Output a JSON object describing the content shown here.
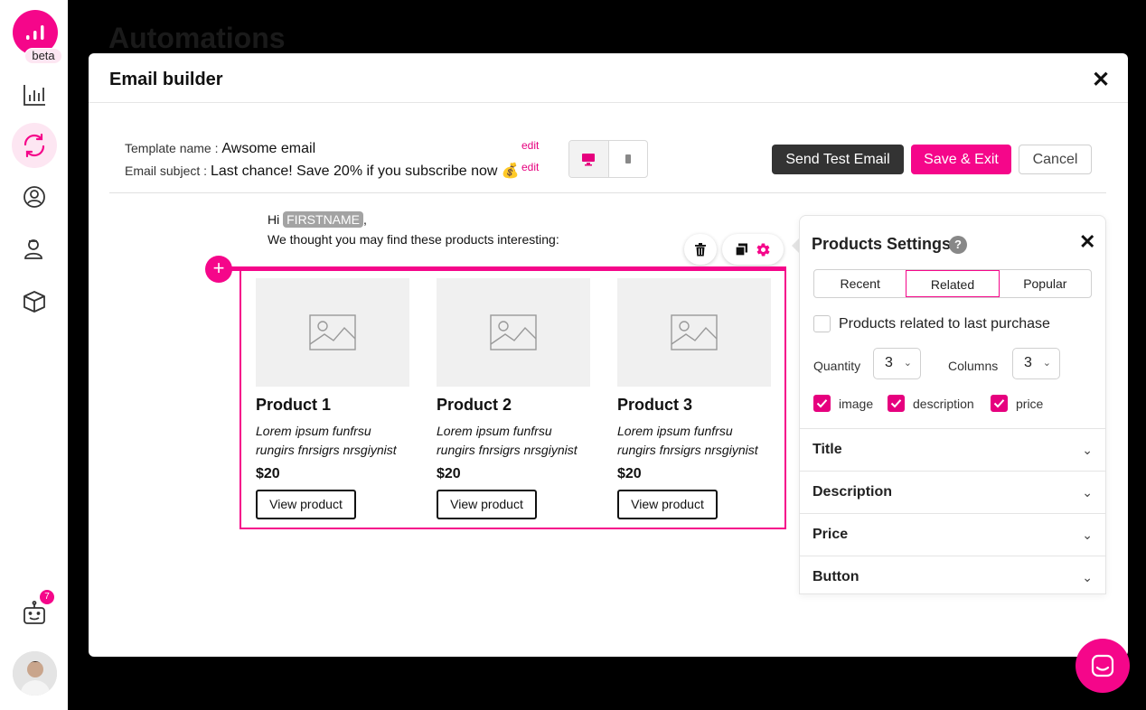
{
  "background": {
    "page_title": "Automations"
  },
  "sidebar": {
    "beta_label": "beta",
    "items": [
      {
        "icon": "analytics-icon"
      },
      {
        "icon": "automations-icon",
        "active": true
      },
      {
        "icon": "audience-icon"
      },
      {
        "icon": "contacts-icon"
      },
      {
        "icon": "products-icon"
      }
    ],
    "bot_badge_count": "7"
  },
  "modal": {
    "title": "Email builder",
    "close_glyph": "✕",
    "template_name_label": "Template name :",
    "template_name_value": "Awsome email",
    "email_subject_label": "Email subject :",
    "email_subject_value": "Last chance! Save 20% if you subscribe now 💰",
    "edit_label": "edit",
    "buttons": {
      "send_test": "Send Test Email",
      "save_exit": "Save & Exit",
      "cancel": "Cancel"
    }
  },
  "email": {
    "greeting_prefix": "Hi",
    "firstname_tag": "FIRSTNAME",
    "greeting_suffix": ",",
    "intro": "We thought you may find these products interesting:",
    "products": [
      {
        "title": "Product 1",
        "description": "Lorem ipsum funfrsu rungirs fnrsigrs nrsgiynist",
        "price": "$20",
        "button": "View product"
      },
      {
        "title": "Product 2",
        "description": "Lorem ipsum funfrsu rungirs fnrsigrs nrsgiynist",
        "price": "$20",
        "button": "View product"
      },
      {
        "title": "Product 3",
        "description": "Lorem ipsum funfrsu rungirs fnrsigrs nrsgiynist",
        "price": "$20",
        "button": "View product"
      }
    ]
  },
  "settings": {
    "title": "Products Settings",
    "help_glyph": "?",
    "close_glyph": "✕",
    "tabs": [
      "Recent",
      "Related",
      "Popular"
    ],
    "selected_tab": "Related",
    "related_checkbox_label": "Products related to last purchase",
    "quantity_label": "Quantity",
    "quantity_value": "3",
    "columns_label": "Columns",
    "columns_value": "3",
    "options": [
      {
        "label": "image",
        "checked": true
      },
      {
        "label": "description",
        "checked": true
      },
      {
        "label": "price",
        "checked": true
      }
    ],
    "sections": [
      "Title",
      "Description",
      "Price",
      "Button"
    ]
  },
  "colors": {
    "accent": "#f5068a",
    "dark_button": "#333333"
  }
}
